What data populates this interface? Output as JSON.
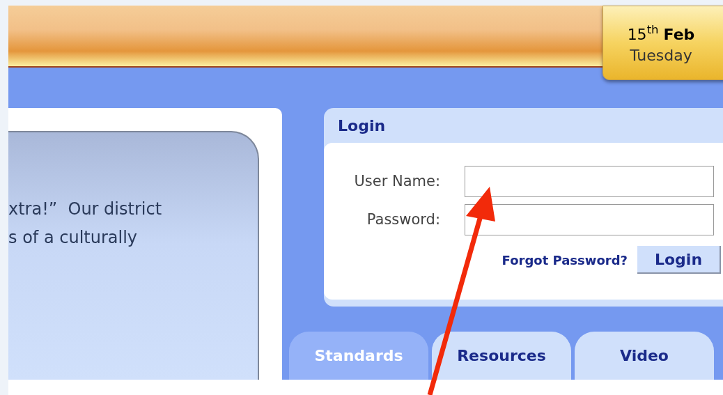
{
  "date_badge": {
    "date": "15$^{th}$ **Feb**",
    "weekday": "Tuesday"
  },
  "intro": {
    "lines": [
      "xtra!”  Our district",
      "s of a culturally"
    ]
  },
  "login": {
    "title": "Login",
    "fields": [
      {
        "label": "User Name:"
      },
      {
        "label": "Password:"
      }
    ],
    "forgot_link": "Forgot Password?",
    "button": "Login"
  },
  "tabs": [
    {
      "label": "Standards",
      "selected": true
    },
    {
      "label": "Resources",
      "selected": false
    },
    {
      "label": "Video",
      "selected": false
    }
  ]
}
